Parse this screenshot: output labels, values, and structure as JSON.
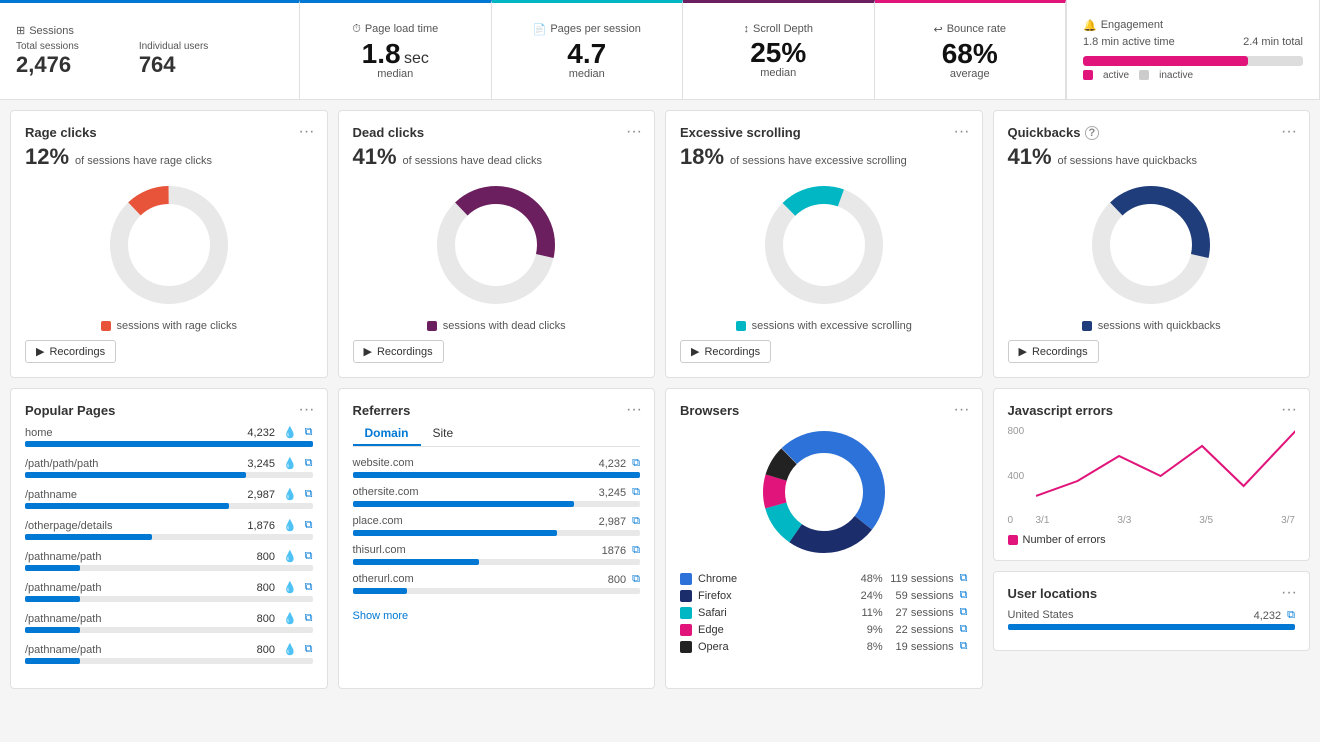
{
  "topbar": {
    "sessions_label": "Sessions",
    "total_sessions_label": "Total sessions",
    "total_sessions_value": "2,476",
    "individual_users_label": "Individual users",
    "individual_users_value": "764",
    "page_load_label": "Page load time",
    "page_load_value": "1.8",
    "page_load_unit": "sec",
    "page_load_sub": "median",
    "pages_per_session_label": "Pages per session",
    "pages_per_session_value": "4.7",
    "pages_per_session_sub": "median",
    "scroll_depth_label": "Scroll Depth",
    "scroll_depth_value": "25%",
    "scroll_depth_sub": "median",
    "bounce_rate_label": "Bounce rate",
    "bounce_rate_value": "68%",
    "bounce_rate_sub": "average",
    "engagement_label": "Engagement",
    "engagement_active_label": "1.8 min active time",
    "engagement_total_label": "2.4 min total",
    "engagement_active": "active",
    "engagement_inactive": "inactive",
    "engagement_bar_pct": 75
  },
  "rage_clicks": {
    "title": "Rage clicks",
    "pct": "12%",
    "desc": "of sessions have rage clicks",
    "color": "#e8543a",
    "legend": "sessions with rage clicks",
    "recordings_btn": "Recordings",
    "donut_value": 12,
    "donut_color": "#e8543a"
  },
  "dead_clicks": {
    "title": "Dead clicks",
    "pct": "41%",
    "desc": "of sessions have dead clicks",
    "color": "#6b1f5e",
    "legend": "sessions with dead clicks",
    "recordings_btn": "Recordings",
    "donut_value": 41,
    "donut_color": "#6b1f5e"
  },
  "excessive_scrolling": {
    "title": "Excessive scrolling",
    "pct": "18%",
    "desc": "of sessions have excessive scrolling",
    "color": "#00b7c3",
    "legend": "sessions with excessive scrolling",
    "recordings_btn": "Recordings",
    "donut_value": 18,
    "donut_color": "#00b7c3"
  },
  "quickbacks": {
    "title": "Quickbacks",
    "pct": "41%",
    "desc": "of sessions have quickbacks",
    "color": "#1f3d7a",
    "legend": "sessions with quickbacks",
    "recordings_btn": "Recordings",
    "donut_value": 41,
    "donut_color": "#1f3d7a"
  },
  "popular_pages": {
    "title": "Popular Pages",
    "pages": [
      {
        "name": "home",
        "value": "4,232",
        "bar_pct": 100
      },
      {
        "name": "/path/path/path",
        "value": "3,245",
        "bar_pct": 77
      },
      {
        "name": "/pathname",
        "value": "2,987",
        "bar_pct": 71
      },
      {
        "name": "/otherpage/details",
        "value": "1,876",
        "bar_pct": 44
      },
      {
        "name": "/pathname/path",
        "value": "800",
        "bar_pct": 19
      },
      {
        "name": "/pathname/path",
        "value": "800",
        "bar_pct": 19
      },
      {
        "name": "/pathname/path",
        "value": "800",
        "bar_pct": 19
      },
      {
        "name": "/pathname/path",
        "value": "800",
        "bar_pct": 19
      }
    ]
  },
  "referrers": {
    "title": "Referrers",
    "tabs": [
      "Domain",
      "Site"
    ],
    "active_tab": "Domain",
    "rows": [
      {
        "name": "website.com",
        "value": "4,232",
        "bar_pct": 100
      },
      {
        "name": "othersite.com",
        "value": "3,245",
        "bar_pct": 77
      },
      {
        "name": "place.com",
        "value": "2,987",
        "bar_pct": 71
      },
      {
        "name": "thisurl.com",
        "value": "1876",
        "bar_pct": 44
      },
      {
        "name": "otherurl.com",
        "value": "800",
        "bar_pct": 19
      }
    ],
    "show_more": "Show more"
  },
  "browsers": {
    "title": "Browsers",
    "items": [
      {
        "name": "Chrome",
        "pct": "48%",
        "sessions": "119 sessions",
        "color": "#2d72d9"
      },
      {
        "name": "Firefox",
        "pct": "24%",
        "sessions": "59 sessions",
        "color": "#1c2d6b"
      },
      {
        "name": "Safari",
        "pct": "11%",
        "sessions": "27 sessions",
        "color": "#00b7c3"
      },
      {
        "name": "Edge",
        "pct": "9%",
        "sessions": "22 sessions",
        "color": "#e0147a"
      },
      {
        "name": "Opera",
        "pct": "8%",
        "sessions": "19 sessions",
        "color": "#222"
      }
    ]
  },
  "js_errors": {
    "title": "Javascript errors",
    "y_labels": [
      "800",
      "400",
      "0"
    ],
    "x_labels": [
      "3/1",
      "3/3",
      "3/5",
      "3/7"
    ],
    "legend": "Number of errors",
    "legend_color": "#e0147a"
  },
  "user_locations": {
    "title": "User locations",
    "rows": [
      {
        "name": "United States",
        "value": "4,232",
        "bar_pct": 100
      }
    ]
  }
}
